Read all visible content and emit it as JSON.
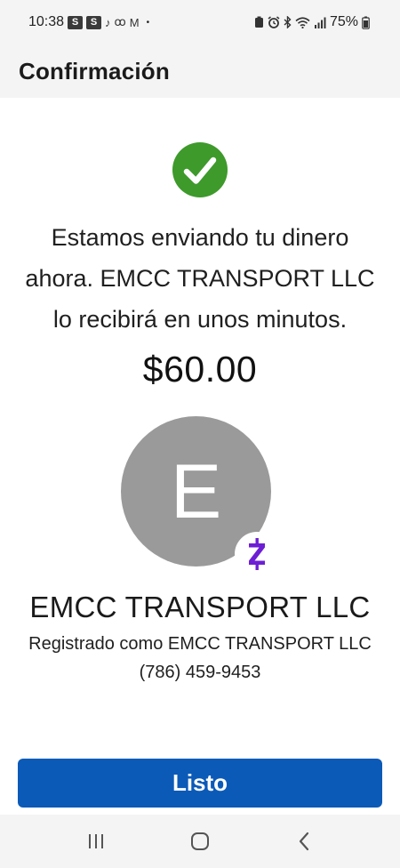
{
  "status_bar": {
    "time": "10:38",
    "notif_1": "S",
    "notif_2": "S",
    "tiktok_icon_glyph": "♪",
    "voicemail_icon_glyph": "ꝏ",
    "gmail_icon_glyph": "M",
    "dot": "•",
    "battery_percent": "75%"
  },
  "header": {
    "title": "Confirmación"
  },
  "confirmation": {
    "message": "Estamos enviando tu dinero ahora. EMCC TRANSPORT LLC lo recibirá en unos minutos.",
    "amount": "$60.00"
  },
  "recipient": {
    "initial": "E",
    "name": "EMCC TRANSPORT LLC",
    "registered_as": "Registrado como EMCC TRANSPORT LLC",
    "phone": "(786) 459-9453"
  },
  "actions": {
    "done_label": "Listo"
  },
  "colors": {
    "success_green": "#3e9a2b",
    "primary_blue": "#0b5ab8",
    "zelle_purple": "#6d1ed4",
    "avatar_gray": "#9a9a9a"
  },
  "icons": {
    "success": "check-circle-icon",
    "zelle": "zelle-logo-icon",
    "nav_recents": "recents-icon",
    "nav_home": "home-icon",
    "nav_back": "back-icon"
  }
}
